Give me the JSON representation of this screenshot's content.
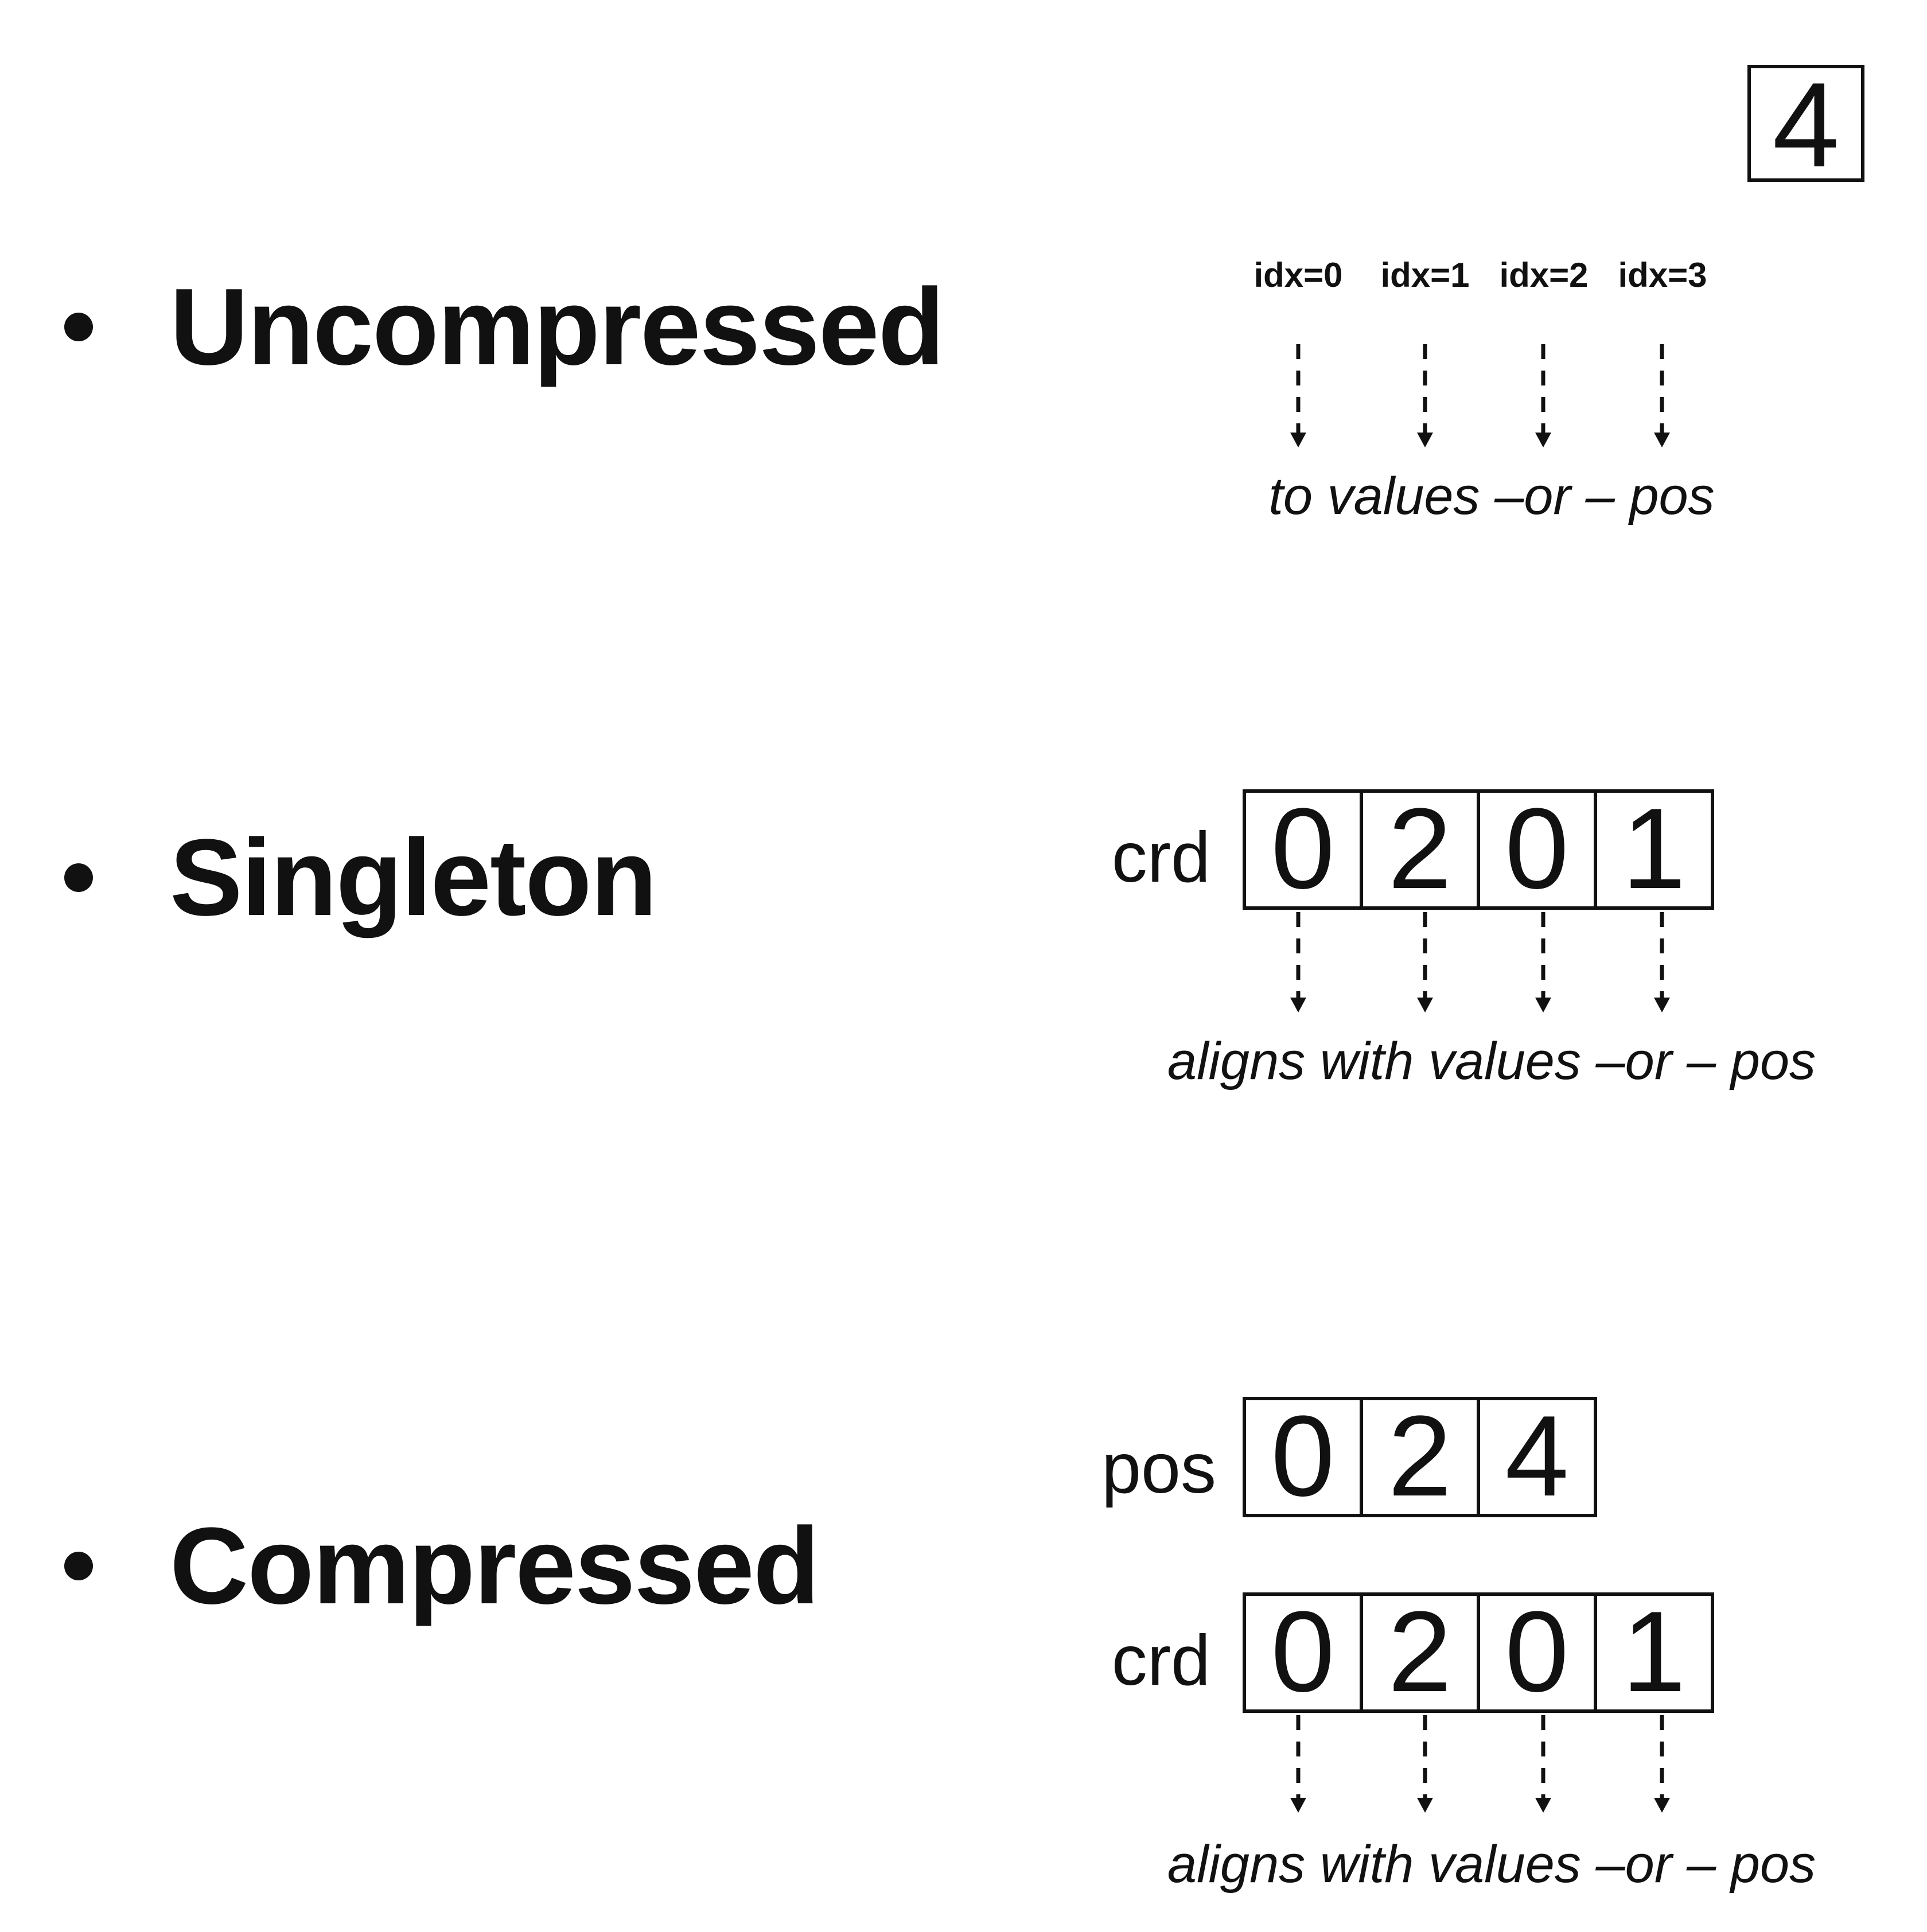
{
  "badge": "4",
  "sections": {
    "uncompressed": {
      "title": "Uncompressed",
      "indices": [
        "idx=0",
        "idx=1",
        "idx=2",
        "idx=3"
      ],
      "caption": "to values –or – pos"
    },
    "singleton": {
      "title": "Singleton",
      "crd_label": "crd",
      "crd": [
        "0",
        "2",
        "0",
        "1"
      ],
      "caption": "aligns with values –or – pos"
    },
    "compressed": {
      "title": "Compressed",
      "pos_label": "pos",
      "pos": [
        "0",
        "2",
        "4"
      ],
      "crd_label": "crd",
      "crd": [
        "0",
        "2",
        "0",
        "1"
      ],
      "caption": "aligns with values –or – pos"
    }
  }
}
